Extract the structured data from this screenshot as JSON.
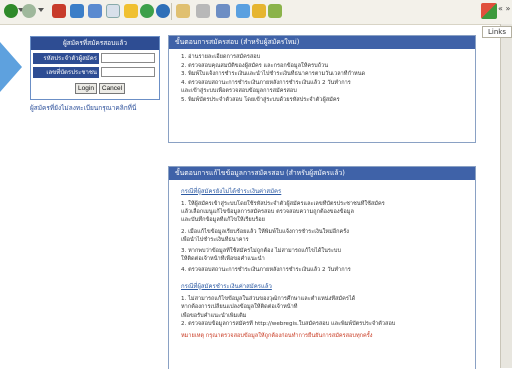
{
  "browser": {
    "toolbar_icons": [
      "back-icon",
      "forward-icon",
      "stop-icon",
      "refresh-icon",
      "home-icon",
      "search-icon",
      "favorites-icon",
      "media-icon",
      "history-icon",
      "mail-icon",
      "print-icon",
      "edit-icon",
      "discuss-icon",
      "messenger-icon",
      "research-icon"
    ],
    "links_label": "Links",
    "mini_links": "« »"
  },
  "login": {
    "title": "ผู้สมัครที่สมัครสอบแล้ว",
    "username_label": "รหัสประจำตัวผู้สมัคร",
    "password_label": "เลขที่บัตรประชาชน",
    "username_value": "",
    "password_value": "",
    "login_button": "Login",
    "cancel_button": "Cancel",
    "register_prompt": "ผู้สมัครที่ยังไม่ลงทะเบียนกรุณาคลิกที่นี่"
  },
  "panel1": {
    "title": "ขั้นตอนการสมัครสอบ (สำหรับผู้สมัครใหม่)",
    "steps": [
      "1. อ่านรายละเอียดการสมัครสอบ",
      "2. ตรวจสอบคุณสมบัติของผู้สมัคร และกรอกข้อมูลให้ครบถ้วน",
      "3. พิมพ์ใบแจ้งการชำระเงินและนำไปชำระเงินที่ธนาคารตามวันเวลาที่กำหนด",
      "4. ตรวจสอบสถานะการชำระเงินภายหลังการชำระเงินแล้ว 2 วันทำการ",
      "   และเข้าสู่ระบบเพื่อตรวจสอบข้อมูลการสมัครสอบ",
      "5. พิมพ์บัตรประจำตัวสอบ โดยเข้าสู่ระบบด้วยรหัสประจำตัวผู้สมัคร"
    ]
  },
  "panel2": {
    "title": "ขั้นตอนการแก้ไขข้อมูลการสมัครสอบ (สำหรับผู้สมัครแล้ว)",
    "section1_title": "กรณีที่ผู้สมัครยังไม่ได้ชำระเงินค่าสมัคร",
    "section1_items": [
      "1. ให้ผู้สมัครเข้าสู่ระบบโดยใช้รหัสประจำตัวผู้สมัครและเลขที่บัตรประชาชนที่ใช้สมัคร",
      "   แล้วเลือกเมนูแก้ไขข้อมูลการสมัครสอบ ตรวจสอบความถูกต้องของข้อมูล",
      "   และบันทึกข้อมูลที่แก้ไขให้เรียบร้อย",
      "2. เมื่อแก้ไขข้อมูลเรียบร้อยแล้ว ให้พิมพ์ใบแจ้งการชำระเงินใหม่อีกครั้ง",
      "   เพื่อนำไปชำระเงินที่ธนาคาร",
      "3. หากพบว่าข้อมูลที่ใช้สมัครไม่ถูกต้อง ไม่สามารถแก้ไขได้ในระบบ",
      "   ให้ติดต่อเจ้าหน้าที่เพื่อขอคำแนะนำ",
      "4. ตรวจสอบสถานะการชำระเงินภายหลังการชำระเงินแล้ว 2 วันทำการ"
    ],
    "section2_title": "กรณีที่ผู้สมัครชำระเงินค่าสมัครแล้ว",
    "section2_items": [
      "1. ไม่สามารถแก้ไขข้อมูลในส่วนของวุฒิการศึกษาและตำแหน่งที่สมัครได้",
      "   หากต้องการเปลี่ยนแปลงข้อมูลให้ติดต่อเจ้าหน้าที่",
      "   เพื่อขอรับคำแนะนำเพิ่มเติม",
      "2. ตรวจสอบข้อมูลการสมัครที่ http://webregis.ใบสมัครสอบ และพิมพ์บัตรประจำตัวสอบ"
    ],
    "warning": "หมายเหตุ กรุณาตรวจสอบข้อมูลให้ถูกต้องก่อนทำการยืนยันการสมัครสอบทุกครั้ง"
  },
  "colors": {
    "panel_header": "#3f62a8",
    "login_header": "#2e4d93",
    "accent_arrow": "#5ea1de",
    "link_blue": "#2b4f9a",
    "warning_red": "#c93a22"
  }
}
